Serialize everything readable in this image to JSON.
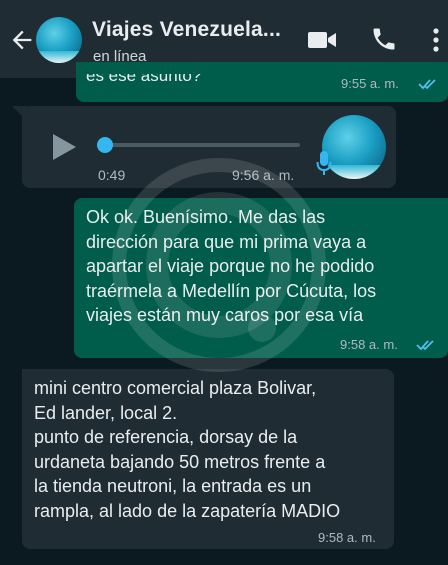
{
  "header": {
    "contact_name": "Viajes Venezuela...",
    "status": "en línea",
    "back_icon": "back-arrow-icon",
    "video_icon": "video-call-icon",
    "call_icon": "phone-icon",
    "menu_icon": "more-vert-icon"
  },
  "messages": [
    {
      "direction": "outgoing",
      "text": "es ese asunto?",
      "time": "9:55 a. m.",
      "read": true
    },
    {
      "direction": "incoming",
      "type": "voice_note",
      "duration": "0:49",
      "time": "9:56 a. m.",
      "progress": 0
    },
    {
      "direction": "outgoing",
      "lines": [
        "Ok ok. Buenísimo. Me das las",
        "dirección para que mi prima vaya a",
        "apartar el viaje porque no he podido",
        "traérmela a Medellín por Cúcuta, los",
        "viajes están muy caros por esa vía"
      ],
      "time": "9:58 a. m.",
      "read": true
    },
    {
      "direction": "incoming",
      "lines": [
        "mini centro comercial plaza Bolivar,",
        "Ed lander, local 2.",
        "punto de referencia, dorsay de la",
        "urdaneta bajando 50 metros frente a",
        "la tienda neutroni, la entrada es un",
        "rampla, al lado de la zapatería MADIO"
      ],
      "time": "9:58 a. m."
    }
  ],
  "colors": {
    "header_bg": "#1f2c33",
    "chat_bg": "#0b1a20",
    "outgoing_bubble": "#005c4b",
    "incoming_bubble": "#202c33",
    "read_ticks": "#53bdeb",
    "voice_accent": "#34b7f1"
  }
}
